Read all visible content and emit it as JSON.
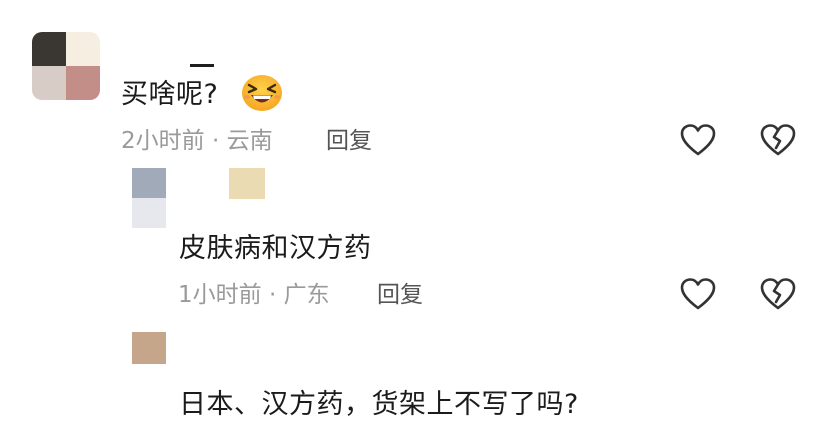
{
  "comments": [
    {
      "text": "买啥呢?",
      "emoji": "laughing-face-emoji",
      "meta": "2小时前 · 云南",
      "reply_label": "回复",
      "replies": [
        {
          "text": "皮肤病和汉方药",
          "meta": "1小时前 · 广东",
          "reply_label": "回复"
        },
        {
          "text": "日本、汉方药，货架上不写了吗?"
        }
      ]
    }
  ],
  "icons": {
    "like": "heart-outline-icon",
    "dislike": "broken-heart-icon"
  },
  "colors": {
    "text": "#1b1b1b",
    "meta": "#9a9a9a",
    "reply": "#555555",
    "icon": "#333333"
  }
}
